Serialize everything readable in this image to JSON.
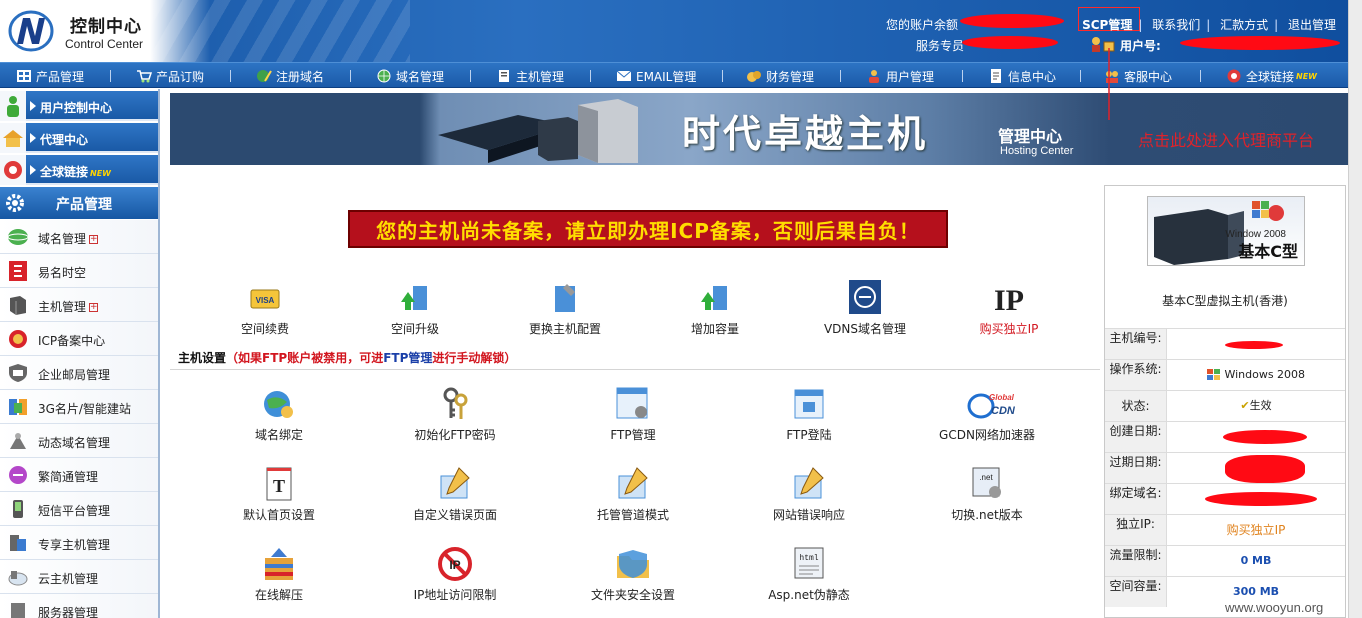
{
  "header": {
    "logo_cn": "控制中心",
    "logo_en": "Control Center",
    "balance_label": "您的账户余额",
    "service_label": "服务专员",
    "links": [
      "SCP管理",
      "联系我们",
      "汇款方式",
      "退出管理"
    ],
    "user_label": "用户号:"
  },
  "nav": {
    "items": [
      {
        "label": "产品管理",
        "icon": "grid-icon"
      },
      {
        "label": "产品订购",
        "icon": "cart-icon"
      },
      {
        "label": "注册域名",
        "icon": "globe-pen-icon"
      },
      {
        "label": "域名管理",
        "icon": "globe-icon"
      },
      {
        "label": "主机管理",
        "icon": "server-icon"
      },
      {
        "label": "EMAIL管理",
        "icon": "mail-icon"
      },
      {
        "label": "财务管理",
        "icon": "money-icon"
      },
      {
        "label": "用户管理",
        "icon": "user-icon"
      },
      {
        "label": "信息中心",
        "icon": "document-icon"
      },
      {
        "label": "客服中心",
        "icon": "support-icon"
      },
      {
        "label": "全球链接",
        "icon": "global-link-icon",
        "badge": "NEW"
      }
    ]
  },
  "sidebar": {
    "top": [
      {
        "label": "用户控制中心"
      },
      {
        "label": "代理中心"
      },
      {
        "label": "全球链接",
        "badge": "NEW"
      }
    ],
    "product_header": "产品管理",
    "items": [
      {
        "label": "域名管理",
        "plus": "+"
      },
      {
        "label": "易名时空"
      },
      {
        "label": "主机管理",
        "plus": "+"
      },
      {
        "label": "ICP备案中心"
      },
      {
        "label": "企业邮局管理"
      },
      {
        "label": "3G名片/智能建站"
      },
      {
        "label": "动态域名管理"
      },
      {
        "label": "繁简通管理"
      },
      {
        "label": "短信平台管理"
      },
      {
        "label": "专享主机管理"
      },
      {
        "label": "云主机管理"
      },
      {
        "label": "服务器管理"
      }
    ]
  },
  "banner": {
    "title": "时代卓越主机",
    "sub": "管理中心",
    "sub_en": "Hosting Center"
  },
  "annotation": "点击此处进入代理商平台",
  "warning": "您的主机尚未备案，请立即办理ICP备案，否则后果自负！",
  "top_actions": [
    {
      "label": "空间续费",
      "icon": "visa-card-icon"
    },
    {
      "label": "空间升级",
      "icon": "upgrade-icon"
    },
    {
      "label": "更换主机配置",
      "icon": "config-icon"
    },
    {
      "label": "增加容量",
      "icon": "capacity-icon"
    },
    {
      "label": "VDNS域名管理",
      "icon": "vdns-icon"
    },
    {
      "label": "购买独立IP",
      "icon": "ip-icon",
      "red": true
    }
  ],
  "section": {
    "title": "主机设置",
    "note_a": "（如果FTP账户被禁用，可进",
    "note_link": "FTP管理",
    "note_b": "进行手动解锁）"
  },
  "host_settings": [
    {
      "label": "域名绑定",
      "icon": "globe-bind-icon"
    },
    {
      "label": "初始化FTP密码",
      "icon": "keys-icon"
    },
    {
      "label": "FTP管理",
      "icon": "ftp-window-icon"
    },
    {
      "label": "FTP登陆",
      "icon": "ftp-login-icon"
    },
    {
      "label": "GCDN网络加速器",
      "icon": "global-cdn-icon"
    },
    {
      "label": "默认首页设置",
      "icon": "homepage-icon"
    },
    {
      "label": "自定义错误页面",
      "icon": "error-page-icon"
    },
    {
      "label": "托管管道模式",
      "icon": "pipeline-icon"
    },
    {
      "label": "网站错误响应",
      "icon": "error-response-icon"
    },
    {
      "label": "切换.net版本",
      "icon": "dotnet-icon"
    },
    {
      "label": "在线解压",
      "icon": "unzip-icon"
    },
    {
      "label": "IP地址访问限制",
      "icon": "ip-restrict-icon"
    },
    {
      "label": "文件夹安全设置",
      "icon": "folder-security-icon"
    },
    {
      "label": "Asp.net伪静态",
      "icon": "html-icon"
    }
  ],
  "product": {
    "img_line1": "Window 2008",
    "img_line2": "基本C型",
    "name": "基本C型虚拟主机(香港)",
    "rows": [
      {
        "k": "主机编号:",
        "v": ""
      },
      {
        "k": "操作系统:",
        "v": "Windows 2008"
      },
      {
        "k": "状态:",
        "v": "生效"
      },
      {
        "k": "创建日期:",
        "v": ""
      },
      {
        "k": "过期日期:",
        "v": ""
      },
      {
        "k": "绑定域名:",
        "v": ""
      },
      {
        "k": "独立IP:",
        "v": "购买独立IP"
      },
      {
        "k": "流量限制:",
        "v": "0 MB"
      },
      {
        "k": "空间容量:",
        "v": "300 MB"
      }
    ]
  },
  "watermark": "www.wooyun.org"
}
